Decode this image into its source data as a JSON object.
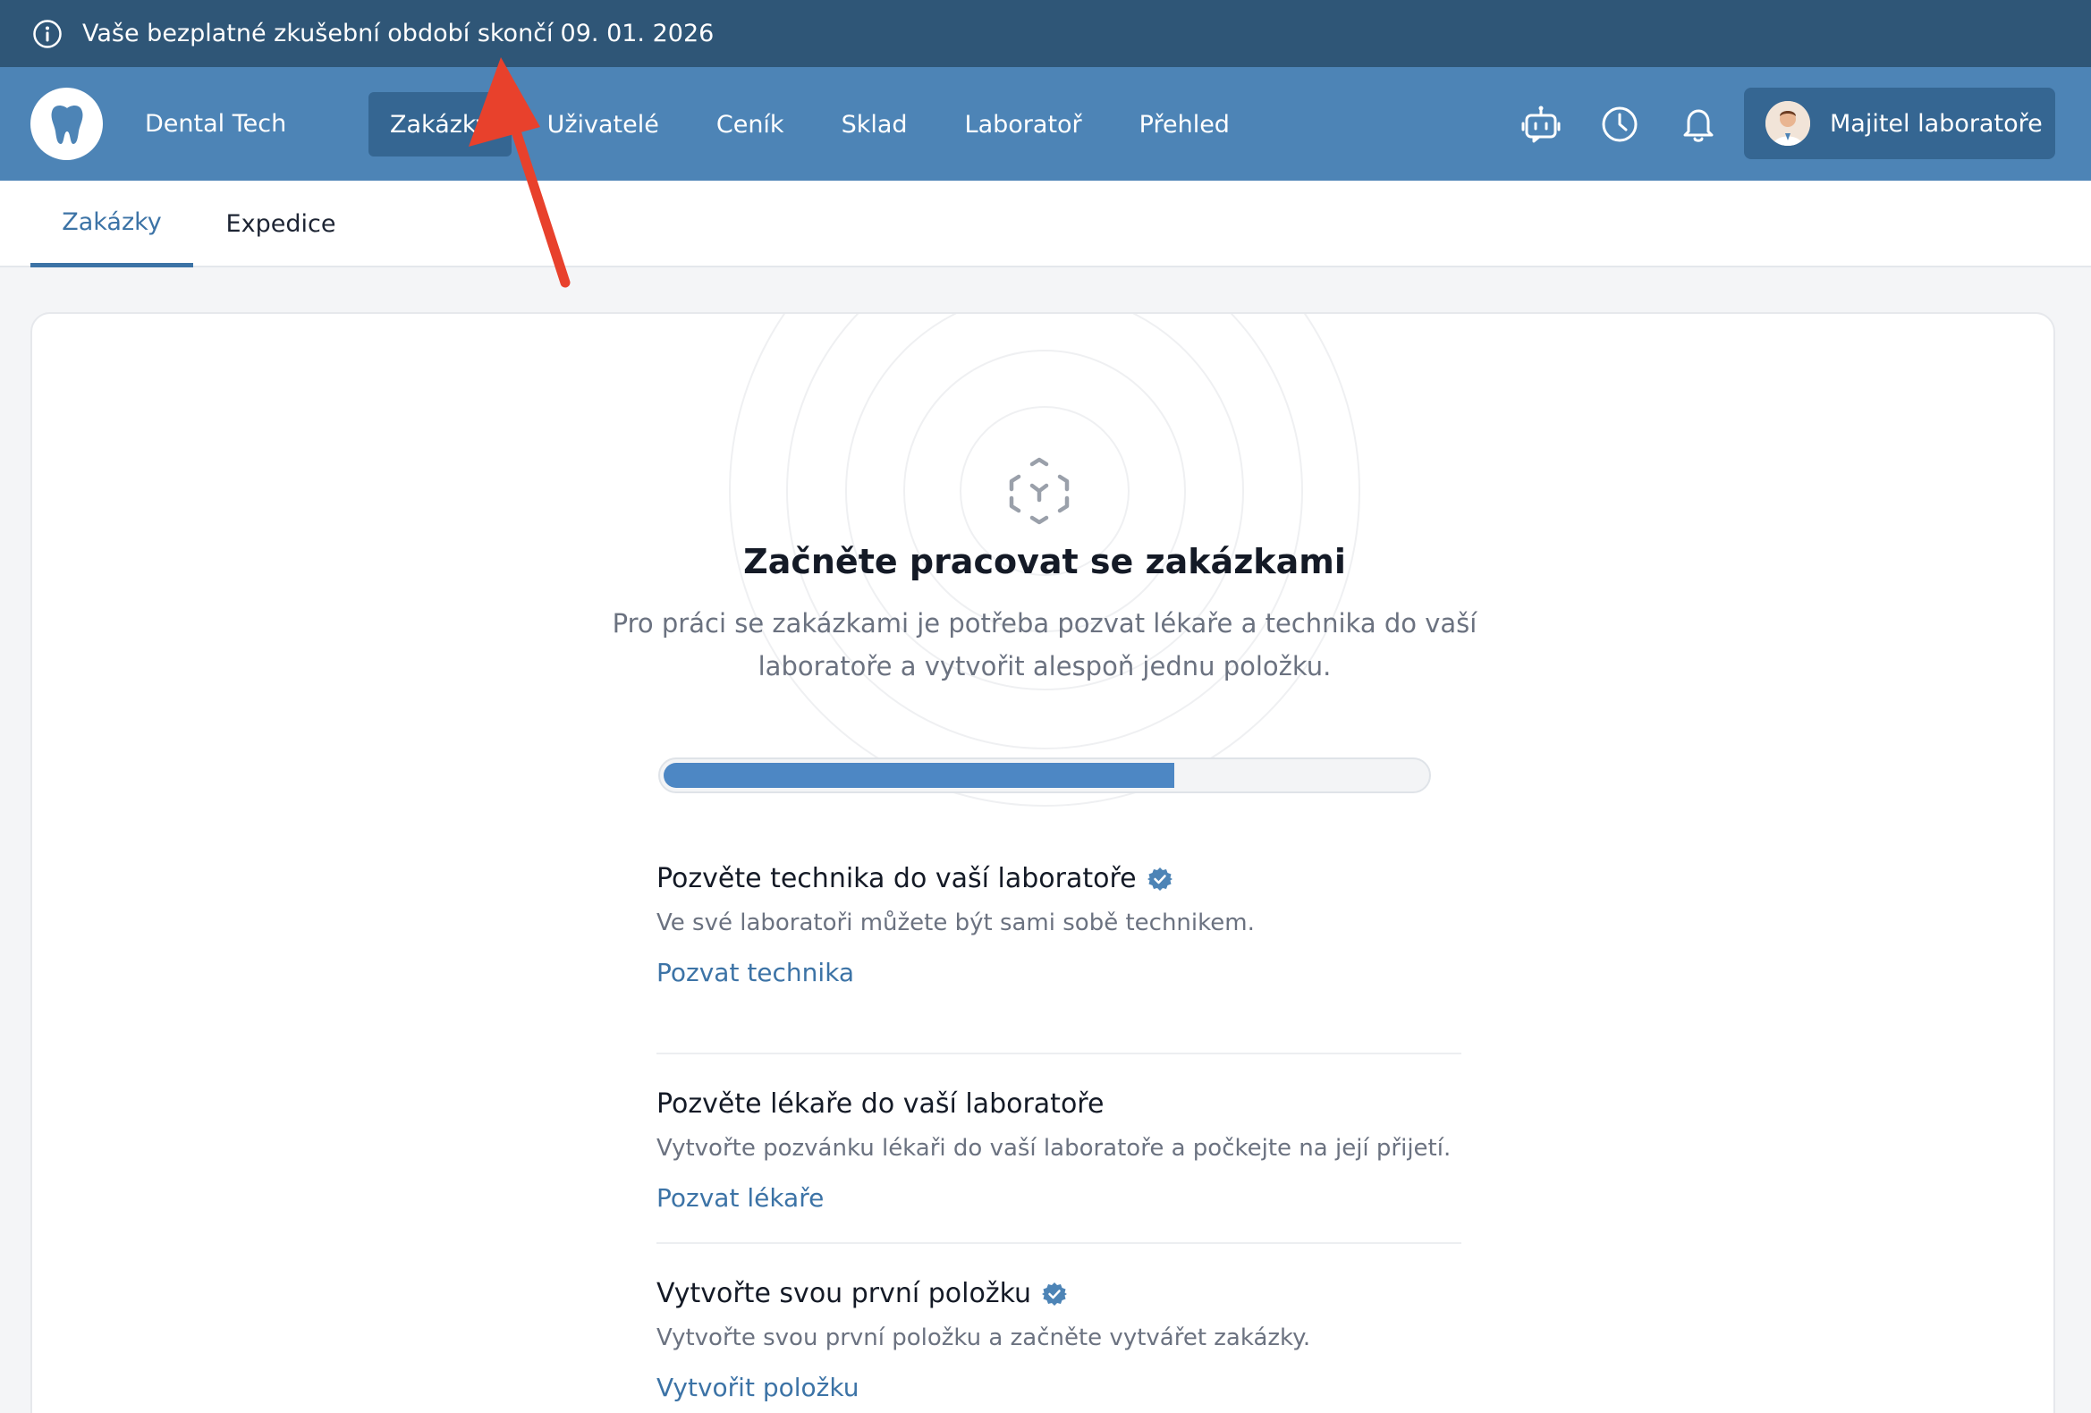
{
  "trial_banner": {
    "icon": "info-icon",
    "text": "Vaše bezplatné zkušební období skončí",
    "date": "09. 01. 2026"
  },
  "nav": {
    "brand": "Dental Tech",
    "logo_icon": "tooth-icon",
    "items": [
      "Zakázky",
      "Uživatelé",
      "Ceník",
      "Sklad",
      "Laboratoř",
      "Přehled"
    ],
    "active_item": "Zakázky",
    "icons": [
      "robot-icon",
      "clock-icon",
      "bell-icon"
    ],
    "user_label": "Majitel laboratoře"
  },
  "sub_tabs": {
    "items": [
      "Zakázky",
      "Expedice"
    ],
    "active": "Zakázky"
  },
  "onboarding": {
    "title": "Začněte pracovat se zakázkami",
    "description": "Pro práci se zakázkami je potřeba pozvat lékaře a technika do vaší laboratoře a vytvořit alespoň jednu položku.",
    "progress_fraction": 0.67,
    "steps": [
      {
        "title": "Pozvěte technika do vaší laboratoře",
        "completed": true,
        "description": "Ve své laboratoři můžete být sami sobě technikem.",
        "link": "Pozvat technika"
      },
      {
        "title": "Pozvěte lékaře do vaší laboratoře",
        "completed": false,
        "description": "Vytvořte pozvánku lékaři do vaší laboratoře a počkejte na její přijetí.",
        "link": "Pozvat lékaře"
      },
      {
        "title": "Vytvořte svou první položku",
        "completed": true,
        "description": "Vytvořte svou první položku a začněte vytvářet zakázky.",
        "link": "Vytvořit položku"
      }
    ]
  },
  "colors": {
    "banner": "#2f5677",
    "nav": "#4d84b6",
    "nav_active": "#356692",
    "accent": "#3c73a6",
    "progress": "#4d87c4",
    "annotation_arrow": "#e8412c"
  }
}
